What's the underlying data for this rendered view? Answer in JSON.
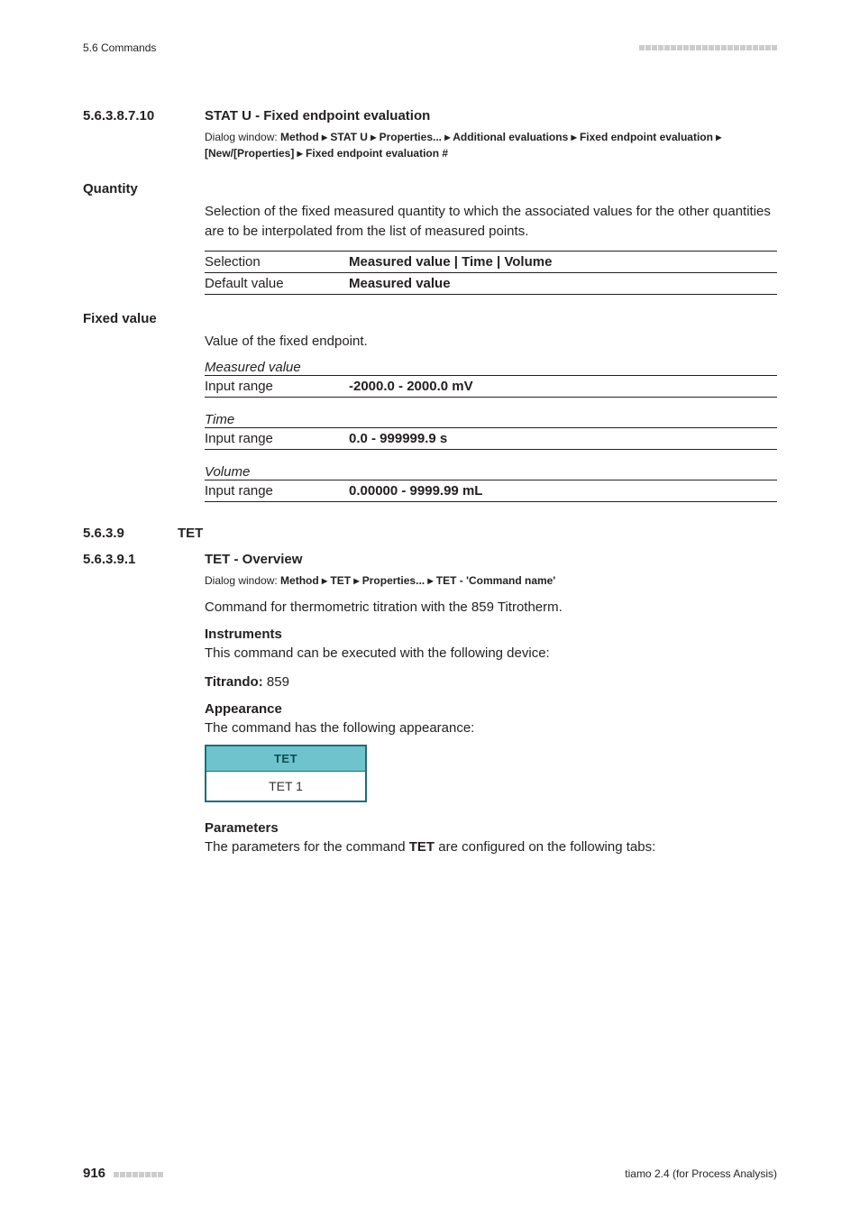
{
  "header": {
    "left": "5.6 Commands"
  },
  "s1": {
    "num": "5.6.3.8.7.10",
    "title": "STAT U - Fixed endpoint evaluation",
    "dlg_prefix": "Dialog window: ",
    "dlg_text": "Method ▸ STAT U ▸ Properties... ▸ Additional evaluations ▸ Fixed endpoint evaluation ▸ [New/[Properties] ▸ Fixed endpoint evaluation #"
  },
  "quantity": {
    "label": "Quantity",
    "desc": "Selection of the fixed measured quantity to which the associated values for the other quantities are to be interpolated from the list of measured points.",
    "row1_k": "Selection",
    "row1_v": "Measured value | Time | Volume",
    "row2_k": "Default value",
    "row2_v": "Measured value"
  },
  "fixed": {
    "label": "Fixed value",
    "desc": "Value of the fixed endpoint.",
    "mv_label": "Measured value",
    "mv_k": "Input range",
    "mv_v": "-2000.0 - 2000.0 mV",
    "t_label": "Time",
    "t_k": "Input range",
    "t_v": "0.0 - 999999.9 s",
    "v_label": "Volume",
    "v_k": "Input range",
    "v_v": "0.00000 - 9999.99 mL"
  },
  "s2": {
    "num": "5.6.3.9",
    "title": "TET"
  },
  "s3": {
    "num": "5.6.3.9.1",
    "title": "TET - Overview",
    "dlg_prefix": "Dialog window: ",
    "dlg_text": "Method ▸ TET ▸ Properties... ▸ TET - 'Command name'",
    "desc": "Command for thermometric titration with the 859 Titrotherm.",
    "instruments_h": "Instruments",
    "instruments_t": "This command can be executed with the following device:",
    "titrando_label": "Titrando:",
    "titrando_value": " 859",
    "appearance_h": "Appearance",
    "appearance_t": "The command has the following appearance:",
    "tet_head": "TET",
    "tet_body": "TET 1",
    "params_h": "Parameters",
    "params_t1": "The parameters for the command ",
    "params_bold": "TET",
    "params_t2": " are configured on the following tabs:"
  },
  "footer": {
    "page": "916",
    "right": "tiamo 2.4 (for Process Analysis)"
  }
}
